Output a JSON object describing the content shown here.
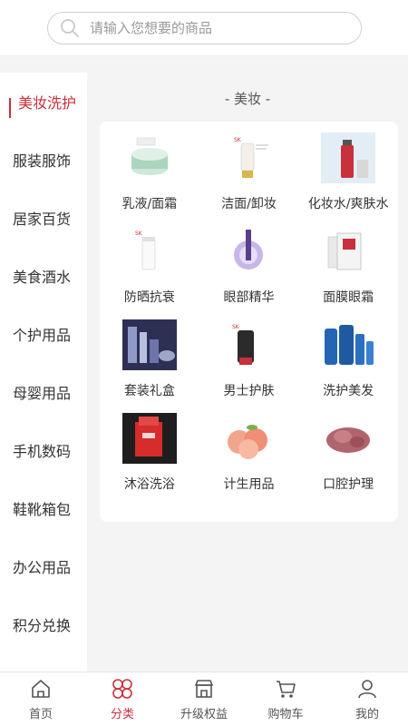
{
  "search": {
    "placeholder": "请输入您想要的商品"
  },
  "sidebar": {
    "items": [
      {
        "label": "美妆洗护"
      },
      {
        "label": "服装服饰"
      },
      {
        "label": "居家百货"
      },
      {
        "label": "美食酒水"
      },
      {
        "label": "个护用品"
      },
      {
        "label": "母婴用品"
      },
      {
        "label": "手机数码"
      },
      {
        "label": "鞋靴箱包"
      },
      {
        "label": "办公用品"
      },
      {
        "label": "积分兑换"
      }
    ]
  },
  "main": {
    "section_title": "- 美妆 -",
    "categories": [
      {
        "label": "乳液/面霜"
      },
      {
        "label": "洁面/卸妆"
      },
      {
        "label": "化妆水/爽肤水"
      },
      {
        "label": "防晒抗衰"
      },
      {
        "label": "眼部精华"
      },
      {
        "label": "面膜眼霜"
      },
      {
        "label": "套装礼盒"
      },
      {
        "label": "男士护肤"
      },
      {
        "label": "洗护美发"
      },
      {
        "label": "沐浴洗浴"
      },
      {
        "label": "计生用品"
      },
      {
        "label": "口腔护理"
      }
    ]
  },
  "tabbar": {
    "tabs": [
      {
        "label": "首页",
        "icon": "home-icon"
      },
      {
        "label": "分类",
        "icon": "category-icon"
      },
      {
        "label": "升级权益",
        "icon": "store-icon"
      },
      {
        "label": "购物车",
        "icon": "cart-icon"
      },
      {
        "label": "我的",
        "icon": "user-icon"
      }
    ],
    "active_index": 1
  },
  "colors": {
    "accent": "#c8303b",
    "background": "#f4f4f4"
  }
}
